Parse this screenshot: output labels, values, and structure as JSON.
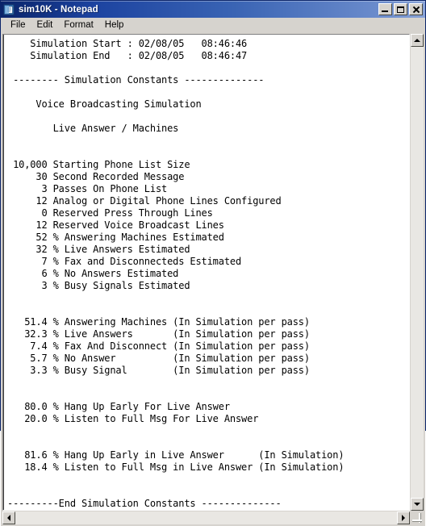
{
  "window": {
    "title": "sim10K - Notepad",
    "icon": "notepad-icon",
    "controls": {
      "minimize_label": "Minimize",
      "maximize_label": "Maximize",
      "close_label": "Close"
    }
  },
  "menu": {
    "items": [
      {
        "label": "File"
      },
      {
        "label": "Edit"
      },
      {
        "label": "Format"
      },
      {
        "label": "Help"
      }
    ]
  },
  "document": {
    "filename": "sim10K",
    "header": {
      "simulation_start_label": "Simulation Start",
      "simulation_start_date": "02/08/05",
      "simulation_start_time": "08:46:46",
      "simulation_end_label": "Simulation End",
      "simulation_end_date": "02/08/05",
      "simulation_end_time": "08:46:47"
    },
    "section_title": "-------- Simulation Constants --------------",
    "subtitle_1": "Voice Broadcasting Simulation",
    "subtitle_2": "Live Answer / Machines",
    "constants": [
      {
        "value": "10,000",
        "unit": "",
        "label": "Starting Phone List Size"
      },
      {
        "value": "30",
        "unit": "",
        "label": "Second Recorded Message"
      },
      {
        "value": "3",
        "unit": "",
        "label": "Passes On Phone List"
      },
      {
        "value": "12",
        "unit": "",
        "label": "Analog or Digital Phone Lines Configured"
      },
      {
        "value": "0",
        "unit": "",
        "label": "Reserved Press Through Lines"
      },
      {
        "value": "12",
        "unit": "",
        "label": "Reserved Voice Broadcast Lines"
      },
      {
        "value": "52",
        "unit": "%",
        "label": "Answering Machines Estimated"
      },
      {
        "value": "32",
        "unit": "%",
        "label": "Live Answers Estimated"
      },
      {
        "value": "7",
        "unit": "%",
        "label": "Fax and Disconnecteds Estimated"
      },
      {
        "value": "6",
        "unit": "%",
        "label": "No Answers Estimated"
      },
      {
        "value": "3",
        "unit": "%",
        "label": "Busy Signals Estimated"
      }
    ],
    "per_pass_results": [
      {
        "value": "51.4",
        "unit": "%",
        "label": "Answering Machines",
        "note": "(In Simulation per pass)"
      },
      {
        "value": "32.3",
        "unit": "%",
        "label": "Live Answers",
        "note": "(In Simulation per pass)"
      },
      {
        "value": "7.4",
        "unit": "%",
        "label": "Fax And Disconnect",
        "note": "(In Simulation per pass)"
      },
      {
        "value": "5.7",
        "unit": "%",
        "label": "No Answer",
        "note": "(In Simulation per pass)"
      },
      {
        "value": "3.3",
        "unit": "%",
        "label": "Busy Signal",
        "note": "(In Simulation per pass)"
      }
    ],
    "live_answer_config": [
      {
        "value": "80.0",
        "unit": "%",
        "label": "Hang Up Early For Live Answer",
        "note": ""
      },
      {
        "value": "20.0",
        "unit": "%",
        "label": "Listen to Full Msg For Live Answer",
        "note": ""
      }
    ],
    "live_answer_results": [
      {
        "value": "81.6",
        "unit": "%",
        "label": "Hang Up Early in Live Answer",
        "note": "(In Simulation)"
      },
      {
        "value": "18.4",
        "unit": "%",
        "label": "Listen to Full Msg in Live Answer",
        "note": "(In Simulation)"
      }
    ],
    "footer": "---------End Simulation Constants --------------",
    "body_text": "    Simulation Start : 02/08/05   08:46:46\n    Simulation End   : 02/08/05   08:46:47\n\n -------- Simulation Constants --------------\n\n     Voice Broadcasting Simulation\n\n        Live Answer / Machines\n\n\n 10,000 Starting Phone List Size\n     30 Second Recorded Message\n      3 Passes On Phone List\n     12 Analog or Digital Phone Lines Configured\n      0 Reserved Press Through Lines\n     12 Reserved Voice Broadcast Lines\n     52 % Answering Machines Estimated\n     32 % Live Answers Estimated\n      7 % Fax and Disconnecteds Estimated\n      6 % No Answers Estimated\n      3 % Busy Signals Estimated\n\n\n   51.4 % Answering Machines (In Simulation per pass)\n   32.3 % Live Answers       (In Simulation per pass)\n    7.4 % Fax And Disconnect (In Simulation per pass)\n    5.7 % No Answer          (In Simulation per pass)\n    3.3 % Busy Signal        (In Simulation per pass)\n\n\n   80.0 % Hang Up Early For Live Answer\n   20.0 % Listen to Full Msg For Live Answer\n\n\n   81.6 % Hang Up Early in Live Answer      (In Simulation)\n   18.4 % Listen to Full Msg in Live Answer (In Simulation)\n\n\n---------End Simulation Constants --------------"
  },
  "scrollbars": {
    "vertical": {
      "up_label": "Scroll up",
      "down_label": "Scroll down"
    },
    "horizontal": {
      "left_label": "Scroll left",
      "right_label": "Scroll right"
    },
    "resize_grip": "resize-grip"
  },
  "colors": {
    "title_gradient_start": "#0a246a",
    "title_gradient_end": "#8aa4d8",
    "window_face": "#d6d3ce",
    "text_area_bg": "#ffffff",
    "text_color": "#000000"
  }
}
